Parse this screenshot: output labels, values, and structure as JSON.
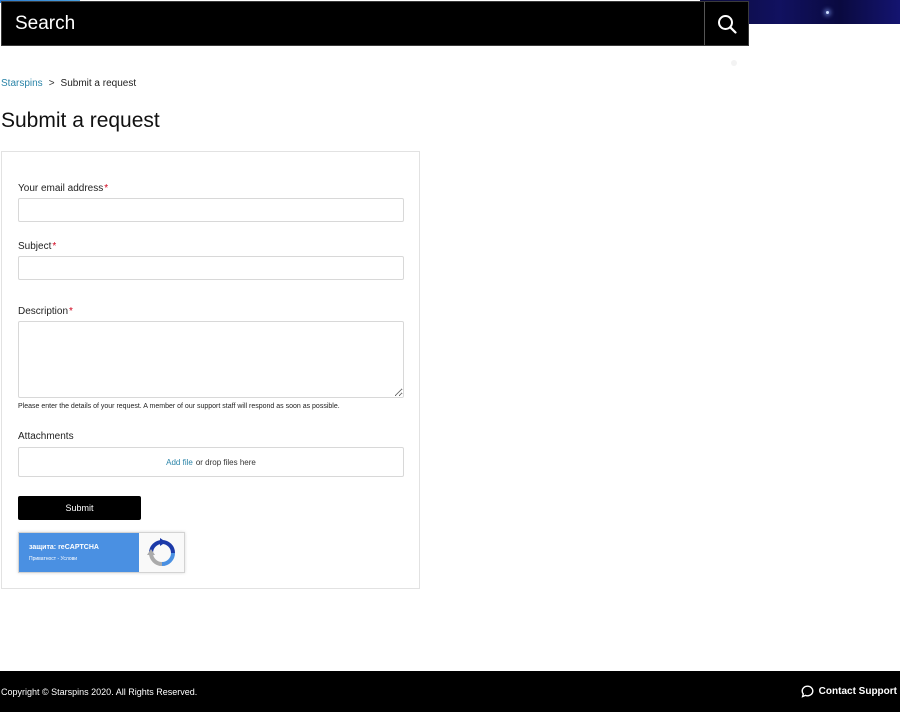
{
  "header": {
    "search_placeholder": "Search",
    "search_icon": "search-icon"
  },
  "breadcrumb": {
    "home": "Starspins",
    "separator": ">",
    "current": "Submit a request"
  },
  "page_title": "Submit a request",
  "form": {
    "email_label": "Your email address",
    "subject_label": "Subject",
    "description_label": "Description",
    "required_marker": "*",
    "email_value": "",
    "subject_value": "",
    "description_value": "",
    "description_hint": "Please enter the details of your request. A member of our support staff will respond as soon as possible.",
    "attachments_label": "Attachments",
    "add_file_link": "Add file",
    "drop_text": "or drop files here",
    "submit_label": "Submit"
  },
  "recaptcha": {
    "title": "защита: reCAPTCHA",
    "links": "Приватност - Услови"
  },
  "footer": {
    "copyright": "Copyright © Starspins 2020. All Rights Reserved.",
    "contact_label": "Contact Support",
    "contact_icon": "chat-bubble-icon"
  },
  "colors": {
    "link": "#2a84a8",
    "required": "#d0021b",
    "recaptcha_blue": "#4a90e2",
    "header_bg": "#000000"
  }
}
